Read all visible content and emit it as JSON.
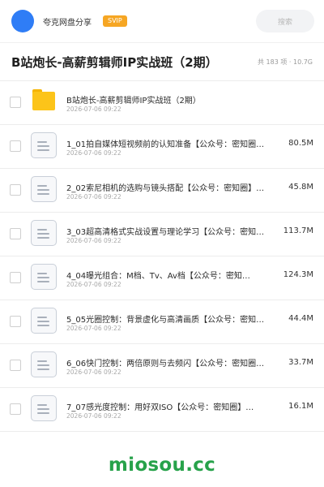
{
  "header": {
    "share_name": "夸克网盘分享",
    "badge": "SVIP",
    "search_placeholder": "搜索"
  },
  "folder": {
    "title": "B站炮长-高薪剪辑师IP实战班（2期）",
    "meta": "共 183 项 · 10.7G"
  },
  "files": [
    {
      "type": "folder",
      "name": "B站炮长-高薪剪辑师IP实战班（2期）",
      "date": "2026-07-06 09:22",
      "size": ""
    },
    {
      "type": "doc",
      "name": "1_01拍自媒体短视频前的认知准备【公众号：密知圈…",
      "date": "2026-07-06 09:22",
      "size": "80.5M"
    },
    {
      "type": "doc",
      "name": "2_02索尼相机的选购与镜头搭配【公众号：密知圈】…",
      "date": "2026-07-06 09:22",
      "size": "45.8M"
    },
    {
      "type": "doc",
      "name": "3_03超高清格式实战设置与理论学习【公众号：密知…",
      "date": "2026-07-06 09:22",
      "size": "113.7M"
    },
    {
      "type": "doc",
      "name": "4_04曝光组合：M档、Tv、Av档【公众号：密知…",
      "date": "2026-07-06 09:22",
      "size": "124.3M"
    },
    {
      "type": "doc",
      "name": "5_05光圈控制：背景虚化与高清画质【公众号：密知…",
      "date": "2026-07-06 09:22",
      "size": "44.4M"
    },
    {
      "type": "doc",
      "name": "6_06快门控制：两倍原则与去频闪【公众号：密知圈…",
      "date": "2026-07-06 09:22",
      "size": "33.7M"
    },
    {
      "type": "doc",
      "name": "7_07感光度控制：用好双ISO【公众号：密知圈】…",
      "date": "2026-07-06 09:22",
      "size": "16.1M"
    }
  ],
  "watermark": "miosou.cc",
  "colors": {
    "avatar": "#2f7df6",
    "badge": "#f6a623",
    "folder_icon": "#fcc419",
    "watermark": "#27a24a"
  }
}
